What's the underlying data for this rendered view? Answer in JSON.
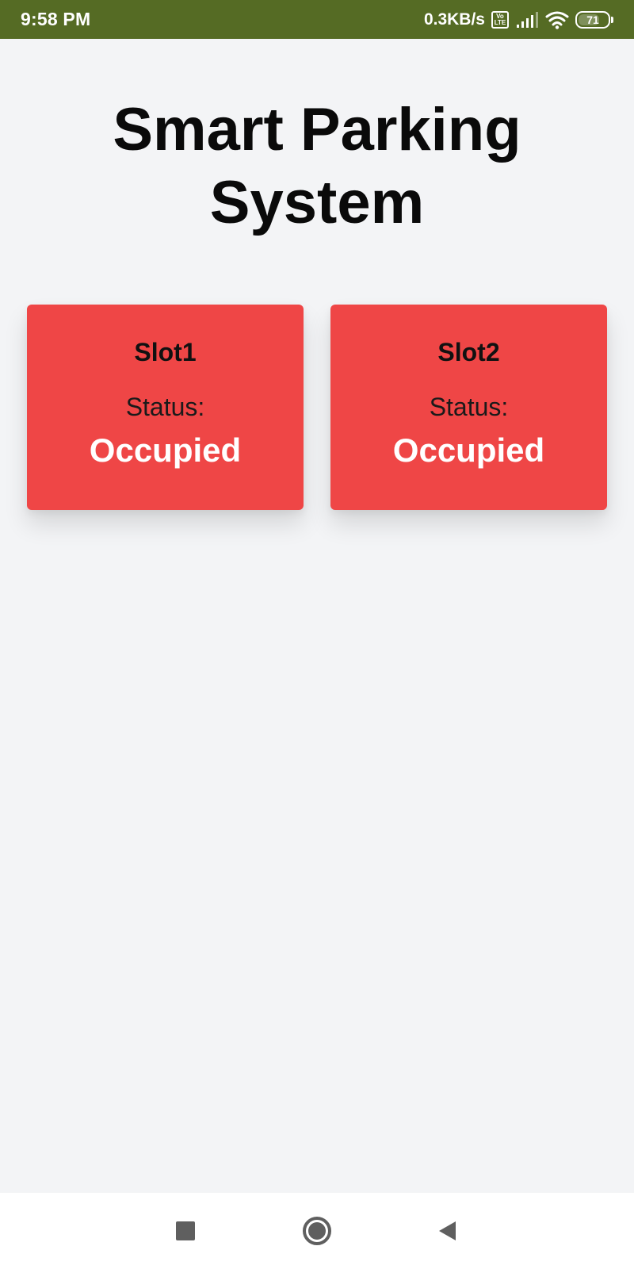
{
  "status_bar": {
    "time": "9:58 PM",
    "network_speed": "0.3KB/s",
    "volte_top": "Vo",
    "volte_bottom": "LTE",
    "battery_level": "71",
    "battery_fraction": 0.71,
    "bg_color": "#556b24"
  },
  "page": {
    "title_line1": "Smart Parking",
    "title_line2": "System"
  },
  "slots": [
    {
      "name": "Slot1",
      "status_label": "Status:",
      "status_value": "Occupied",
      "color": "#ef4646"
    },
    {
      "name": "Slot2",
      "status_label": "Status:",
      "status_value": "Occupied",
      "color": "#ef4646"
    }
  ],
  "nav_bar": {
    "icons": [
      "recent-apps-icon",
      "home-icon",
      "back-icon"
    ]
  }
}
